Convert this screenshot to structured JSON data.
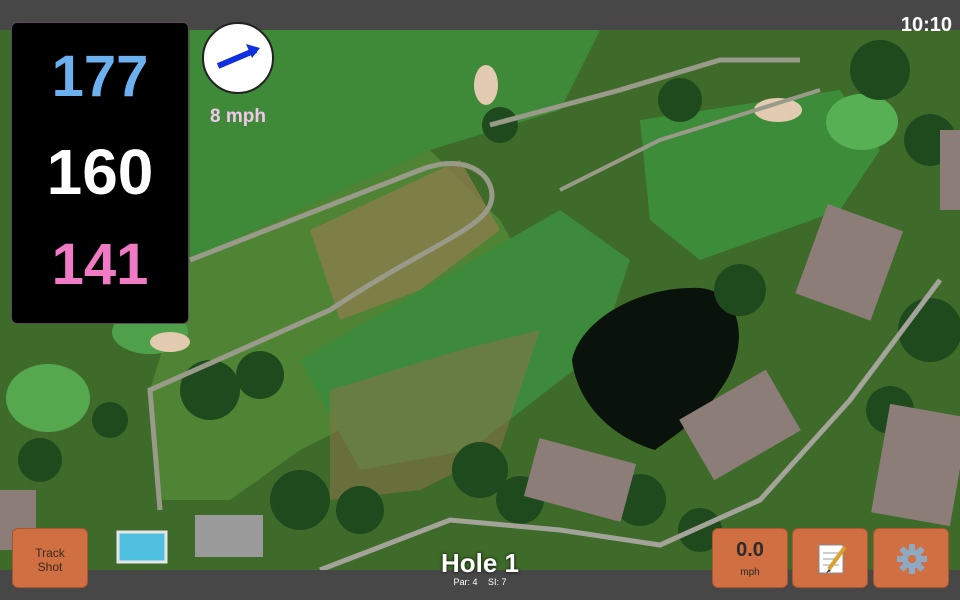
{
  "clock": "10:10",
  "distances": {
    "front": "177",
    "middle": "160",
    "back": "141"
  },
  "wind": {
    "speed_label": "8 mph",
    "icon": "wind-arrow-icon"
  },
  "buttons": {
    "track_shot_line1": "Track",
    "track_shot_line2": "Shot",
    "speed_value": "0.0",
    "speed_unit": "mph",
    "notes_icon": "notepad-icon",
    "settings_icon": "gear-icon"
  },
  "hole": {
    "title": "Hole 1",
    "par": "Par: 4",
    "si": "SI: 7"
  },
  "colors": {
    "front": "#6cb0f0",
    "middle": "#ffffff",
    "back": "#f07ac4",
    "button": "#cf6f42",
    "bar": "#474747"
  }
}
